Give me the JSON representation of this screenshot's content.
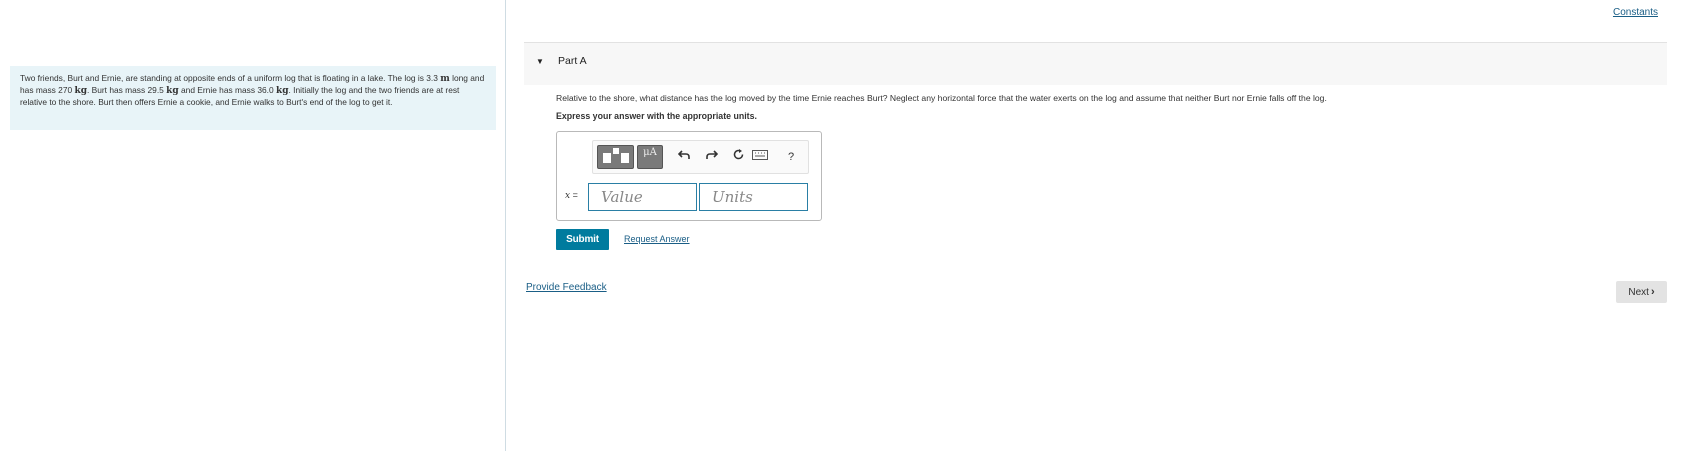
{
  "header": {
    "constants_link": "Constants"
  },
  "problem": {
    "seg1": "Two friends, Burt and Ernie, are standing at opposite ends of a uniform log that is floating in a lake. The log is 3.3 ",
    "unit_m": "m",
    "seg2": " long and has mass 270 ",
    "unit_kg1": "kg",
    "seg3": ". Burt has mass 29.5 ",
    "unit_kg2": "kg",
    "seg4": " and Ernie has mass 36.0 ",
    "unit_kg3": "kg",
    "seg5": ". Initially the log and the two friends are at rest relative to the shore. Burt then offers Ernie a cookie, and Ernie walks to Burt's end of the log to get it."
  },
  "part": {
    "title": "Part A",
    "question": "Relative to the shore, what distance has the log moved by the time Ernie reaches Burt? Neglect any horizontal force that the water exerts on the log and assume that neither Burt nor Ernie falls off the log.",
    "instruction": "Express your answer with the appropriate units."
  },
  "toolbar": {
    "units_label": "μA",
    "undo_icon": "undo-icon",
    "redo_icon": "redo-icon",
    "reset_icon": "reset-icon",
    "keyboard_icon": "keyboard-icon",
    "help_label": "?"
  },
  "answer": {
    "variable": "x",
    "equals": " =",
    "value_placeholder": "Value",
    "units_placeholder": "Units"
  },
  "actions": {
    "submit_label": "Submit",
    "request_answer_label": "Request Answer",
    "feedback_label": "Provide Feedback",
    "next_label": "Next"
  },
  "colors": {
    "problem_bg": "#e8f4f8",
    "submit_bg": "#007b9e",
    "link": "#1a5e86",
    "input_border": "#2a7fa5"
  }
}
